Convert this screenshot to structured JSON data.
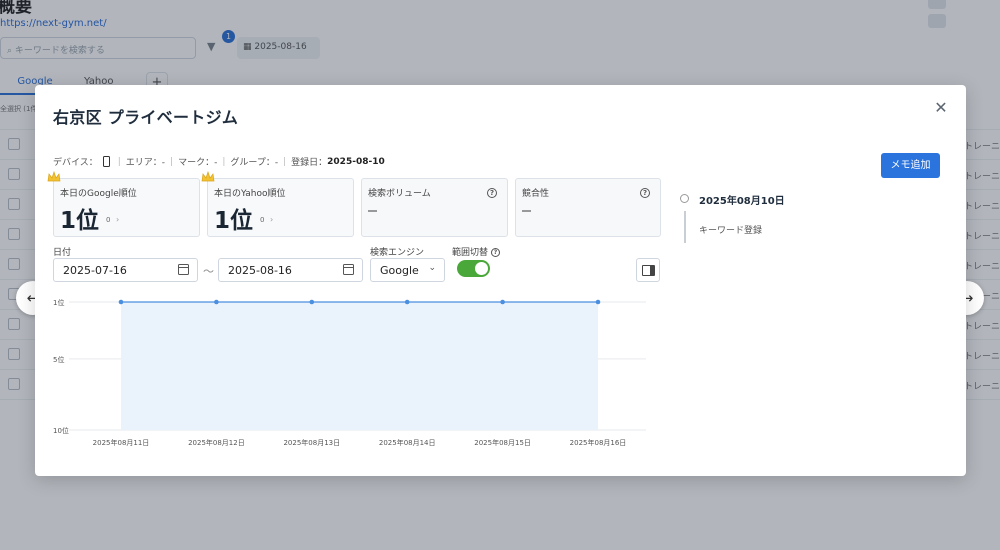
{
  "background": {
    "page_title": "概要",
    "url": "https://next-gym.net/",
    "search_placeholder": "キーワードを検索する",
    "filter_badge": "1",
    "date": "2025-08-16",
    "tabs": [
      "Google",
      "Yahoo"
    ],
    "add_tab": "+",
    "list_header": "全選択 (1件)",
    "row_right": "トレーニ"
  },
  "modal": {
    "title": "右京区 プライベートジム",
    "close": "✕",
    "meta": {
      "device_label": "デバイス：",
      "area_label": "エリア：-",
      "mark_label": "マーク：-",
      "group_label": "グループ：-",
      "registered_label": "登録日：",
      "registered_value": "2025-08-10"
    },
    "memo_button": "メモ追加",
    "cards": {
      "google": {
        "label": "本日のGoogle順位",
        "value": "1位",
        "sub": "0",
        "chevron": "›"
      },
      "yahoo": {
        "label": "本日のYahoo順位",
        "value": "1位",
        "sub": "0",
        "chevron": "›"
      },
      "volume": {
        "label": "検索ボリューム"
      },
      "competition": {
        "label": "競合性"
      }
    },
    "filters": {
      "date_label": "日付",
      "date_from": "2025-07-16",
      "tilde": "～",
      "date_to": "2025-08-16",
      "engine_label": "検索エンジン",
      "engine_value": "Google",
      "range_label": "範囲切替",
      "range_toggle_on": true
    },
    "timeline": {
      "date": "2025年08月10日",
      "event": "キーワード登録"
    }
  },
  "chart_data": {
    "type": "area",
    "title": "",
    "xlabel": "",
    "ylabel": "",
    "y_inverted": true,
    "ylim": [
      1,
      10
    ],
    "y_ticks": [
      {
        "value": 1,
        "label": "1位"
      },
      {
        "value": 5,
        "label": "5位"
      },
      {
        "value": 10,
        "label": "10位"
      }
    ],
    "x": [
      "2025年08月11日",
      "2025年08月12日",
      "2025年08月13日",
      "2025年08月14日",
      "2025年08月15日",
      "2025年08月16日"
    ],
    "series": [
      {
        "values": [
          1,
          1,
          1,
          1,
          1,
          1
        ],
        "color": "#4a8fe0",
        "fill": "#eaf2fc"
      }
    ],
    "grid": true,
    "legend": "none"
  }
}
